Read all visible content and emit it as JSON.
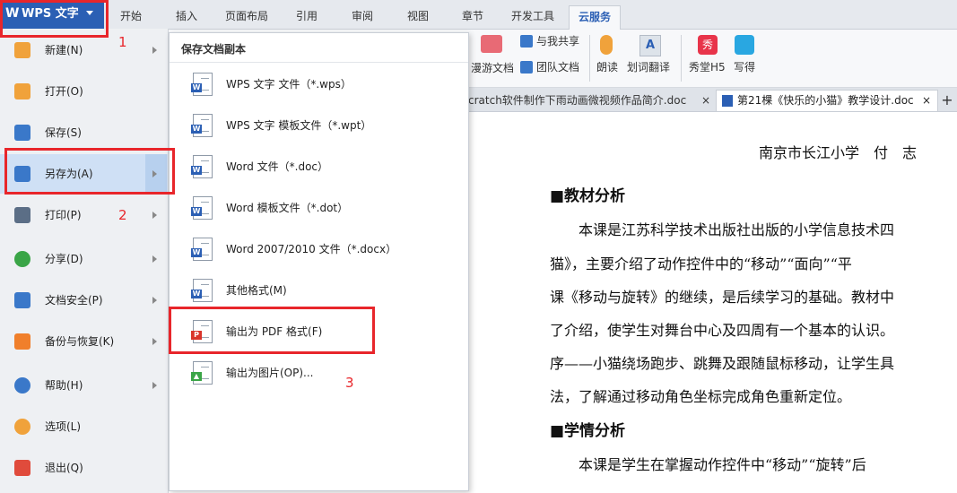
{
  "app": {
    "title": "WPS 文字"
  },
  "ribbon_tabs": [
    {
      "label": "开始"
    },
    {
      "label": "插入"
    },
    {
      "label": "页面布局"
    },
    {
      "label": "引用"
    },
    {
      "label": "审阅"
    },
    {
      "label": "视图"
    },
    {
      "label": "章节"
    },
    {
      "label": "开发工具"
    },
    {
      "label": "云服务",
      "active": true
    }
  ],
  "ribbon": {
    "share_label": "与我共享",
    "tour_doc_label": "漫游文档",
    "team_doc_label": "团队文档",
    "read_label": "朗读",
    "translate_label": "划词翻译",
    "xiutang_label": "秀堂H5",
    "xiede_label": "写得",
    "xiu_icon_text": "秀"
  },
  "doc_tabs": [
    {
      "label": "cratch软件制作下雨动画微视频作品简介.doc"
    },
    {
      "label": "第21棵《快乐的小猫》教学设计.doc"
    }
  ],
  "doc_tab_close": "×",
  "doc_tab_add": "+",
  "left_menu": [
    {
      "label": "新建(N)",
      "icon": "new-icon",
      "color": "#f0a23b",
      "arrow": true
    },
    {
      "label": "打开(O)",
      "icon": "open-folder-icon",
      "color": "#f0a23b",
      "arrow": false
    },
    {
      "label": "保存(S)",
      "icon": "save-icon",
      "color": "#3a78c9",
      "arrow": false
    },
    {
      "label": "另存为(A)",
      "icon": "save-as-icon",
      "color": "#3a78c9",
      "arrow": true,
      "selected": true
    },
    {
      "label": "打印(P)",
      "icon": "print-icon",
      "color": "#5b6e86",
      "arrow": true
    },
    {
      "label": "分享(D)",
      "icon": "share-icon",
      "color": "#3aa547",
      "arrow": true
    },
    {
      "label": "文档安全(P)",
      "icon": "security-icon",
      "color": "#3a78c9",
      "arrow": true
    },
    {
      "label": "备份与恢复(K)",
      "icon": "backup-icon",
      "color": "#f07f2b",
      "arrow": true
    },
    {
      "label": "帮助(H)",
      "icon": "help-icon",
      "color": "#3a78c9",
      "arrow": true
    },
    {
      "label": "选项(L)",
      "icon": "options-gear-icon",
      "color": "#f0a23b",
      "arrow": false
    },
    {
      "label": "退出(Q)",
      "icon": "exit-icon",
      "color": "#e04b3c",
      "arrow": false
    }
  ],
  "submenu": {
    "title": "保存文档副本",
    "items": [
      {
        "label": "WPS 文字 文件（*.wps）",
        "icon": "wps-file-icon",
        "badge": "W",
        "badge_color": "#2b5fb4"
      },
      {
        "label": "WPS 文字 模板文件（*.wpt）",
        "icon": "wps-template-icon",
        "badge": "W",
        "badge_color": "#2b5fb4"
      },
      {
        "label": "Word 文件（*.doc）",
        "icon": "word-doc-icon",
        "badge": "W",
        "badge_color": "#2b5fb4"
      },
      {
        "label": "Word 模板文件（*.dot）",
        "icon": "word-template-icon",
        "badge": "W",
        "badge_color": "#2b5fb4"
      },
      {
        "label": "Word 2007/2010 文件（*.docx）",
        "icon": "word-docx-icon",
        "badge": "W",
        "badge_color": "#2b5fb4"
      },
      {
        "label": "其他格式(M)",
        "icon": "other-format-icon",
        "badge": "W",
        "badge_color": "#2b5fb4"
      },
      {
        "label": "输出为 PDF 格式(F)",
        "icon": "pdf-export-icon",
        "badge": "P",
        "badge_color": "#d9342b"
      },
      {
        "label": "输出为图片(OP)...",
        "icon": "image-export-icon",
        "badge": "▲",
        "badge_color": "#3aa547"
      }
    ]
  },
  "annotations": {
    "one": "1",
    "two": "2",
    "three": "3"
  },
  "document": {
    "author": "南京市长江小学　付　志",
    "heading1": "■教材分析",
    "para1": [
      "　　本课是江苏科学技术出版社出版的小学信息技术四",
      "猫》，主要介绍了动作控件中的“移动”“面向”“平",
      "课《移动与旋转》的继续，是后续学习的基础。教材中",
      "了介绍，使学生对舞台中心及四周有一个基本的认识。",
      "序——小猫绕场跑步、跳舞及跟随鼠标移动，让学生具",
      "法，了解通过移动角色坐标完成角色重新定位。"
    ],
    "heading2": "■学情分析",
    "para2": [
      "　　本课是学生在掌握动作控件中“移动”“旋转”后"
    ]
  }
}
